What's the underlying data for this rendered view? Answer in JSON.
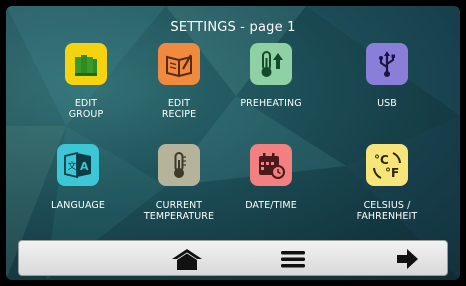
{
  "title": "SETTINGS - page 1",
  "tiles": [
    {
      "label": "EDIT\nGROUP",
      "icon": "books-icon",
      "color": "#f5d311"
    },
    {
      "label": "EDIT\nRECIPE",
      "icon": "recipe-book-icon",
      "color": "#f08a3e"
    },
    {
      "label": "PREHEATING",
      "icon": "thermometer-up-icon",
      "color": "#8fd0a4"
    },
    {
      "label": "USB",
      "icon": "usb-icon",
      "color": "#8a7fd8"
    },
    {
      "label": "LANGUAGE",
      "icon": "language-icon",
      "color": "#3cc6d6"
    },
    {
      "label": "CURRENT\nTEMPERATURE",
      "icon": "thermometer-icon",
      "color": "#b5b39a"
    },
    {
      "label": "DATE/TIME",
      "icon": "calendar-clock-icon",
      "color": "#f28080"
    },
    {
      "label": "CELSIUS /\nFAHRENHEIT",
      "icon": "celsius-fahrenheit-icon",
      "color": "#f7e57a"
    }
  ],
  "nav": [
    {
      "icon": "home-icon"
    },
    {
      "icon": "menu-icon"
    },
    {
      "icon": "arrow-right-icon"
    }
  ]
}
